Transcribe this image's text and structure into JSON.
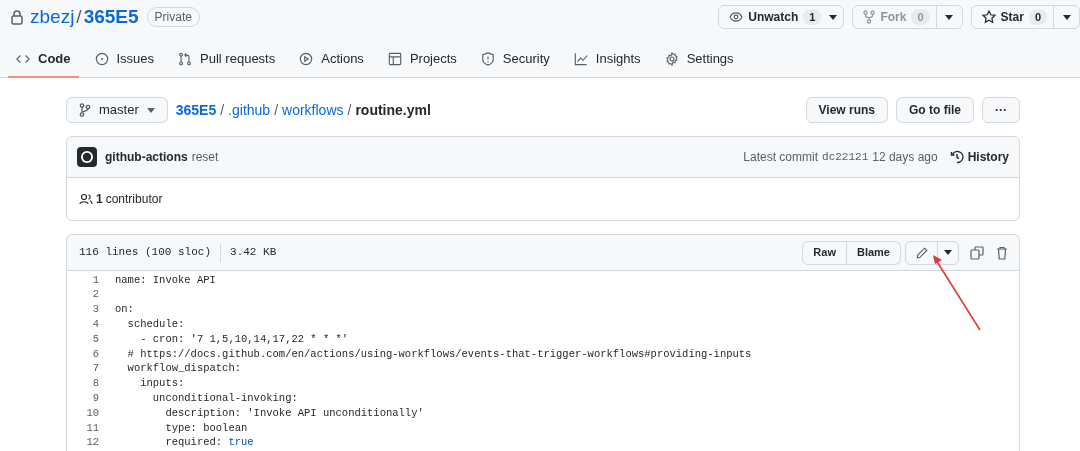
{
  "repo": {
    "owner": "zbezj",
    "separator": "/",
    "name": "365E5",
    "visibility": "Private"
  },
  "repo_actions": [
    {
      "kind": "watch",
      "label": "Unwatch",
      "count": "1",
      "disabled": false
    },
    {
      "kind": "fork",
      "label": "Fork",
      "count": "0",
      "disabled": true
    },
    {
      "kind": "star",
      "label": "Star",
      "count": "0",
      "disabled": false
    }
  ],
  "tabs": [
    {
      "kind": "code",
      "label": "Code",
      "selected": true
    },
    {
      "kind": "issues",
      "label": "Issues",
      "selected": false
    },
    {
      "kind": "pulls",
      "label": "Pull requests",
      "selected": false
    },
    {
      "kind": "actions",
      "label": "Actions",
      "selected": false
    },
    {
      "kind": "projects",
      "label": "Projects",
      "selected": false
    },
    {
      "kind": "security",
      "label": "Security",
      "selected": false
    },
    {
      "kind": "insights",
      "label": "Insights",
      "selected": false
    },
    {
      "kind": "settings",
      "label": "Settings",
      "selected": false
    }
  ],
  "branch": "master",
  "breadcrumb": [
    {
      "text": "365E5",
      "link": true
    },
    {
      "separator": "/",
      "text": ".github",
      "link": true
    },
    {
      "separator": "/",
      "text": "workflows",
      "link": true
    },
    {
      "separator": "/",
      "text": "routine.yml",
      "link": false
    }
  ],
  "file_actions": [
    "View runs",
    "Go to file",
    "···"
  ],
  "commit": {
    "author": "github-actions",
    "message": "reset",
    "latest_label": "Latest commit",
    "sha": "dc22121",
    "time": "12 days ago",
    "history": "History"
  },
  "contributors": {
    "count": "1",
    "label": "contributor"
  },
  "file": {
    "lines_info": "116 lines (100 sloc)",
    "size": "3.42 KB",
    "buttons": [
      "Raw",
      "Blame"
    ]
  },
  "code_lines": [
    {
      "number": "1",
      "text": "name: Invoke API"
    },
    {
      "number": "2"
    },
    {
      "number": "3",
      "text": "on:"
    },
    {
      "number": "4",
      "text": "  schedule:"
    },
    {
      "number": "5",
      "text": "    - cron: '7 1,5,10,14,17,22 * * *'"
    },
    {
      "number": "6",
      "text": "  # https://docs.github.com/en/actions/using-workflows/events-that-trigger-workflows#providing-inputs"
    },
    {
      "number": "7",
      "text": "  workflow_dispatch:"
    },
    {
      "number": "8",
      "text": "    inputs:"
    },
    {
      "number": "9",
      "text": "      unconditional-invoking:"
    },
    {
      "number": "10",
      "text": "        description: 'Invoke API unconditionally'"
    },
    {
      "number": "11",
      "text": "        type: boolean"
    },
    {
      "number": "12",
      "text": "        required: ",
      "literal": "true"
    }
  ]
}
